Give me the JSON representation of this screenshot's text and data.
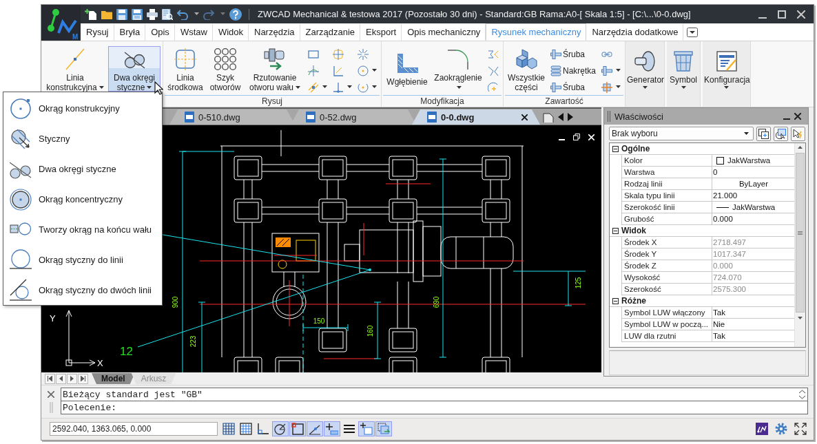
{
  "app_logo": {
    "badge": "M"
  },
  "window": {
    "title": "ZWCAD Mechanical & testowa 2017 (Pozostało 30 dni) - Standard:GB Rama:A0-[ Skala 1:5] - [C:\\...\\0-0.dwg]"
  },
  "ribbon_tabs": [
    {
      "label": "Rysuj",
      "selected": false
    },
    {
      "label": "Bryła",
      "selected": false
    },
    {
      "label": "Opis",
      "selected": false
    },
    {
      "label": "Wstaw",
      "selected": false
    },
    {
      "label": "Widok",
      "selected": false
    },
    {
      "label": "Narzędzia",
      "selected": false
    },
    {
      "label": "Zarządzanie",
      "selected": false
    },
    {
      "label": "Eksport",
      "selected": false
    },
    {
      "label": "Opis mechaniczny",
      "selected": false
    },
    {
      "label": "Rysunek mechaniczny",
      "selected": true
    },
    {
      "label": "Narzędzia dodatkowe",
      "selected": false
    }
  ],
  "ribbon_groups": [
    {
      "kind": "group",
      "large_buttons": [
        {
          "label": "Linia konstrukcyjna",
          "dropdown": true,
          "expanded": false
        },
        {
          "label": "Dwa okręgi styczne",
          "dropdown": true,
          "expanded": true
        }
      ]
    },
    {
      "kind": "group",
      "label": "Rysuj",
      "large_buttons": [
        {
          "label": "Linia środkowa",
          "dropdown": false,
          "expanded": false
        },
        {
          "label": "Szyk otworów",
          "dropdown": false,
          "expanded": false
        },
        {
          "label": "Rzutowanie otworu wału",
          "dropdown": true,
          "expanded": false
        }
      ],
      "small_buttons": [
        {
          "dropdown": false
        },
        {
          "dropdown": false
        },
        {
          "dropdown": true
        },
        {
          "dropdown": false
        },
        {
          "dropdown": false
        },
        {
          "dropdown": true
        },
        {
          "dropdown": false
        },
        {
          "dropdown": true
        },
        {
          "dropdown": true
        }
      ]
    },
    {
      "kind": "group",
      "label": "Modyfikacja",
      "large_buttons": [
        {
          "label": "Wgłębienie",
          "dropdown": false,
          "expanded": false
        },
        {
          "label": "Zaokrąglenie",
          "dropdown": true,
          "expanded": false
        }
      ],
      "small_buttons": [
        {
          "dropdown": false
        },
        {
          "dropdown": false
        },
        {
          "dropdown": false
        }
      ]
    },
    {
      "kind": "group",
      "label": "Zawartość",
      "large_buttons": [
        {
          "label": "Wszystkie części",
          "dropdown": false,
          "expanded": false
        }
      ],
      "small_buttons": [
        {
          "label": "Śruba",
          "dropdown": false
        },
        {
          "label": "Nakrętka",
          "dropdown": false
        },
        {
          "label": "Śruba",
          "dropdown": false
        },
        {
          "dropdown": false
        },
        {
          "dropdown": true
        },
        {
          "dropdown": true
        }
      ]
    },
    {
      "kind": "panel",
      "large_buttons": [
        {
          "label": "Generator",
          "dropdown": true,
          "expanded": false
        }
      ]
    },
    {
      "kind": "panel",
      "large_buttons": [
        {
          "label": "Symbol",
          "dropdown": true,
          "expanded": false
        }
      ]
    },
    {
      "kind": "panel",
      "large_buttons": [
        {
          "label": "Konfiguracja",
          "dropdown": true,
          "expanded": false
        }
      ]
    }
  ],
  "dropdown_menu": {
    "items": [
      {
        "label": "Okrąg konstrukcyjny"
      },
      {
        "label": "Styczny"
      },
      {
        "label": "Dwa okręgi styczne"
      },
      {
        "label": "Okrąg koncentryczny"
      },
      {
        "label": "Tworzy okrąg na końcu wału"
      },
      {
        "label": "Okrąg styczny do linii"
      },
      {
        "label": "Okrąg styczny do dwóch linii"
      }
    ]
  },
  "document_tabs": [
    {
      "label": "0-510.dwg",
      "selected": false
    },
    {
      "label": "0-52.dwg",
      "selected": false
    },
    {
      "label": "0-0.dwg",
      "selected": true
    }
  ],
  "canvas": {
    "dimension_texts": [
      "900",
      "223",
      "150",
      "160",
      "690",
      "125"
    ],
    "callout": "12",
    "ucs": {
      "x_axis": "X",
      "y_axis": "Y"
    }
  },
  "properties": {
    "title": "Właściwości",
    "selection": "Brak wyboru",
    "sections": [
      {
        "title": "Ogólne",
        "expanded": true,
        "rows": [
          {
            "name": "Kolor",
            "value": "JakWarstwa",
            "kind": "color",
            "disabled": false
          },
          {
            "name": "Warstwa",
            "value": "0",
            "kind": "text",
            "disabled": false
          },
          {
            "name": "Rodzaj linii",
            "value": "ByLayer",
            "kind": "linetype",
            "disabled": false
          },
          {
            "name": "Skala typu linii",
            "value": "21.000",
            "kind": "text",
            "disabled": false
          },
          {
            "name": "Szerokość linii",
            "value": "JakWarstwa",
            "kind": "lineweight",
            "disabled": false
          },
          {
            "name": "Grubość",
            "value": "0.000",
            "kind": "text",
            "disabled": false
          }
        ]
      },
      {
        "title": "Widok",
        "expanded": true,
        "rows": [
          {
            "name": "Środek X",
            "value": "2718.497",
            "kind": "text",
            "disabled": true
          },
          {
            "name": "Środek Y",
            "value": "1017.347",
            "kind": "text",
            "disabled": true
          },
          {
            "name": "Środek Z",
            "value": "0.000",
            "kind": "text",
            "disabled": true
          },
          {
            "name": "Wysokość",
            "value": "724.070",
            "kind": "text",
            "disabled": true
          },
          {
            "name": "Szerokość",
            "value": "2575.300",
            "kind": "text",
            "disabled": true
          }
        ]
      },
      {
        "title": "Różne",
        "expanded": true,
        "rows": [
          {
            "name": "Symbol LUW włączony",
            "value": "Tak",
            "kind": "text",
            "disabled": false
          },
          {
            "name": "Symbol LUW w począ...",
            "value": "Nie",
            "kind": "text",
            "disabled": false
          },
          {
            "name": "LUW dla rzutni",
            "value": "Tak",
            "kind": "text",
            "disabled": false
          }
        ]
      }
    ]
  },
  "layout_tabs": [
    {
      "label": "Model",
      "selected": true
    },
    {
      "label": "Arkusz",
      "selected": false
    }
  ],
  "command_line": {
    "history": "Bieżący standard jest \"GB\"",
    "prompt": "Polecenie:"
  },
  "status_bar": {
    "coordinates": "2592.040, 1363.065, 0.000",
    "toggles": [
      {
        "kind": "grid",
        "on": false
      },
      {
        "kind": "snap",
        "on": false
      },
      {
        "kind": "ortho",
        "on": false
      },
      {
        "kind": "polar",
        "on": true
      },
      {
        "kind": "osnap",
        "on": true
      },
      {
        "kind": "otrack",
        "on": true
      },
      {
        "kind": "dynamic_input",
        "on": true
      },
      {
        "kind": "lineweight",
        "on": false
      },
      {
        "kind": "transparency",
        "on": true
      },
      {
        "kind": "selection_cycling",
        "on": true
      }
    ]
  }
}
